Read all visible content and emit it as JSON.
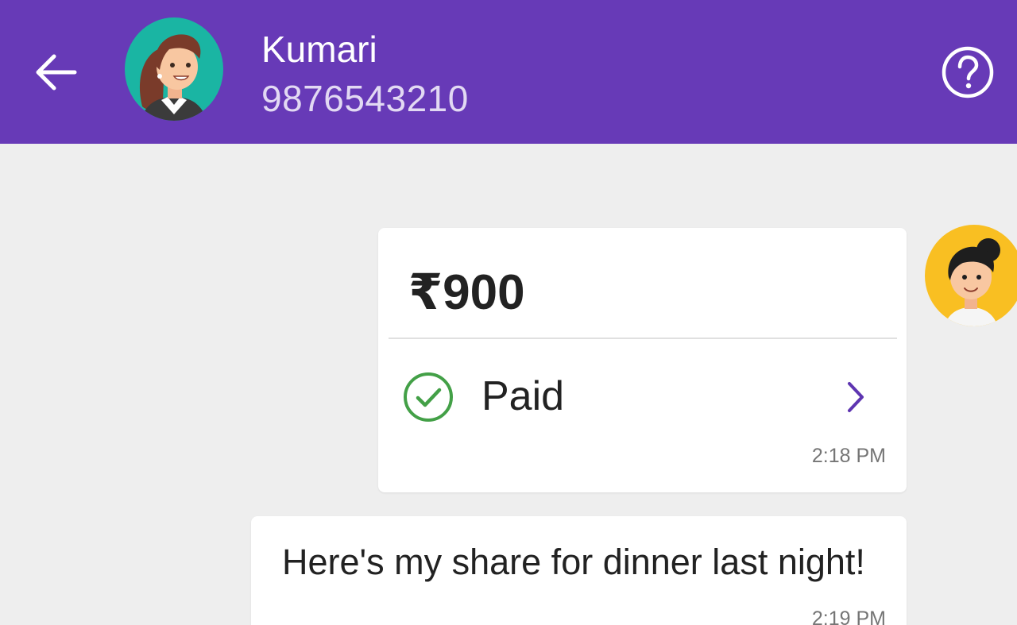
{
  "header": {
    "contact_name": "Kumari",
    "contact_phone": "9876543210",
    "background_color": "#673ab7",
    "icons": {
      "back": "arrow-back-icon",
      "help": "help-circle-icon"
    }
  },
  "chat": {
    "payment": {
      "amount": "₹900",
      "status": "Paid",
      "status_color": "#43a047",
      "time": "2:18 PM"
    },
    "message": {
      "text": "Here's my share for dinner last night!",
      "time": "2:19 PM"
    }
  }
}
